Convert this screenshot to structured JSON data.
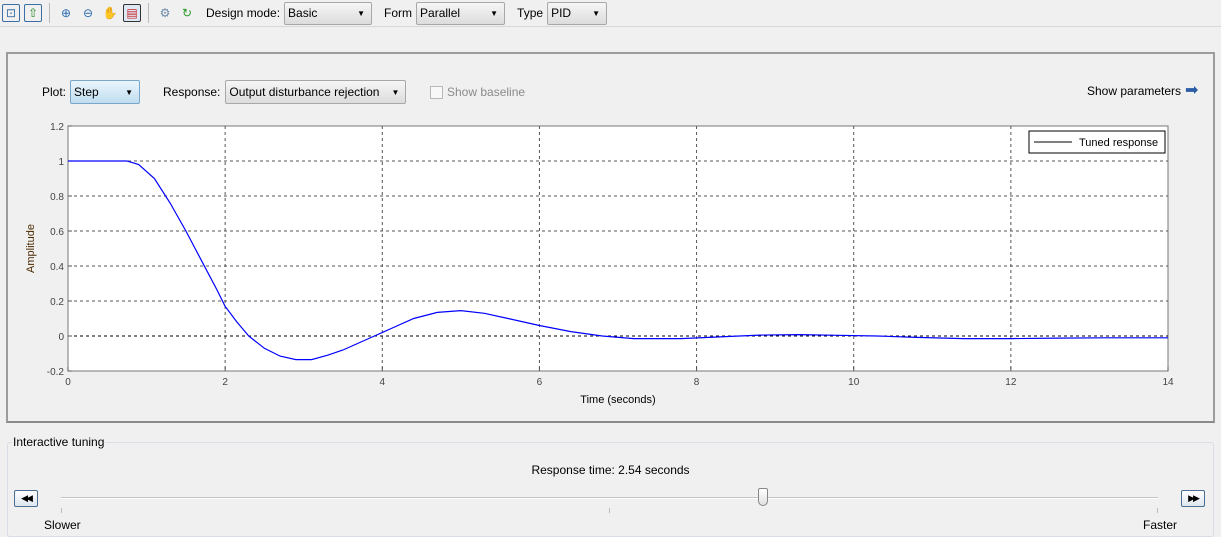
{
  "toolbar": {
    "icons": [
      "import-icon",
      "export-icon",
      "zoom-in-icon",
      "zoom-out-icon",
      "pan-icon",
      "legend-toggle-icon",
      "settings-icon",
      "refresh-icon"
    ],
    "design_mode_label": "Design mode:",
    "design_mode_value": "Basic",
    "form_label": "Form",
    "form_value": "Parallel",
    "type_label": "Type",
    "type_value": "PID"
  },
  "plot_controls": {
    "plot_label": "Plot:",
    "plot_value": "Step",
    "response_label": "Response:",
    "response_value": "Output disturbance rejection",
    "show_baseline_label": "Show baseline",
    "show_baseline_checked": false,
    "show_parameters_label": "Show parameters"
  },
  "chart_data": {
    "type": "line",
    "xlabel": "Time (seconds)",
    "ylabel": "Amplitude",
    "xlim": [
      0,
      14
    ],
    "ylim": [
      -0.2,
      1.2
    ],
    "xticks": [
      "0",
      "2",
      "4",
      "6",
      "8",
      "10",
      "12",
      "14"
    ],
    "yticks": [
      "-0.2",
      "0",
      "0.2",
      "0.4",
      "0.6",
      "0.8",
      "1",
      "1.2"
    ],
    "grid": true,
    "legend_position": "top-right",
    "series": [
      {
        "name": "Tuned response",
        "color": "#0000ff",
        "x": [
          0,
          0.75,
          0.9,
          1.1,
          1.3,
          1.5,
          1.7,
          1.9,
          2.0,
          2.15,
          2.3,
          2.5,
          2.7,
          2.9,
          3.1,
          3.3,
          3.5,
          3.7,
          3.9,
          4.1,
          4.4,
          4.7,
          5.0,
          5.3,
          5.6,
          6.0,
          6.4,
          6.8,
          7.2,
          7.8,
          8.3,
          8.8,
          9.3,
          9.8,
          10.3,
          10.8,
          11.4,
          12.0,
          12.6,
          13.2,
          14.0
        ],
        "values": [
          1,
          1,
          0.98,
          0.9,
          0.76,
          0.6,
          0.43,
          0.26,
          0.17,
          0.08,
          0.0,
          -0.07,
          -0.115,
          -0.135,
          -0.135,
          -0.11,
          -0.08,
          -0.04,
          0.0,
          0.04,
          0.1,
          0.135,
          0.145,
          0.13,
          0.1,
          0.06,
          0.025,
          0.0,
          -0.015,
          -0.015,
          -0.005,
          0.005,
          0.008,
          0.004,
          0.0,
          -0.008,
          -0.015,
          -0.015,
          -0.012,
          -0.01,
          -0.01
        ]
      }
    ]
  },
  "tuning": {
    "title": "Interactive tuning",
    "response_time_text": "Response time: 2.54 seconds",
    "slower_label": "Slower",
    "faster_label": "Faster",
    "slider_fraction": 0.64
  }
}
